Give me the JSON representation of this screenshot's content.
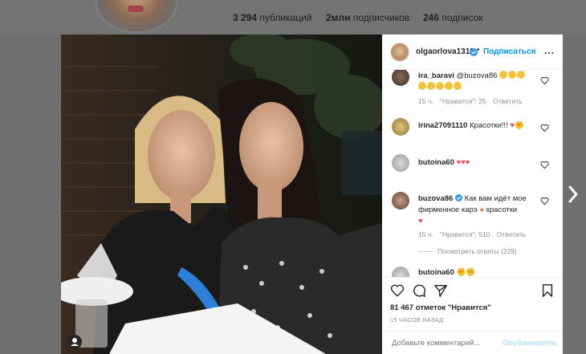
{
  "profile": {
    "posts": "3 294",
    "posts_label": "публикаций",
    "followers": "2млн",
    "followers_label": "подписчиков",
    "following": "246",
    "following_label": "подписок"
  },
  "post": {
    "username": "olgaorlova1311",
    "dot": "•",
    "follow_label": "Подписаться",
    "more": "...",
    "likes": "81 467 отметок \"Нравится\"",
    "time": "15 ЧАСОВ НАЗАД",
    "comment_placeholder": "Добавьте комментарий...",
    "publish_label": "Опубликовать"
  },
  "comments": [
    {
      "user": "ira_baravi",
      "text": "@buzova86",
      "time": "15 ч.",
      "likes": "\"Нравится\": 25",
      "reply": "Ответить"
    },
    {
      "user": "irina27091110",
      "text": "Красотки!!!"
    },
    {
      "user": "butoina60",
      "text": ""
    },
    {
      "user": "buzova86",
      "text": "Как вам идёт мое фирменное карэ",
      "text2": "красотки",
      "time": "15 ч.",
      "likes": "\"Нравится\": 510",
      "reply": "Ответить",
      "replies": "Посмотреть ответы (229)"
    },
    {
      "user": "butoina60",
      "text": ""
    }
  ],
  "colors": {
    "accent": "#0095f6",
    "heart": "#ed4956",
    "verified": "#3897f0"
  }
}
